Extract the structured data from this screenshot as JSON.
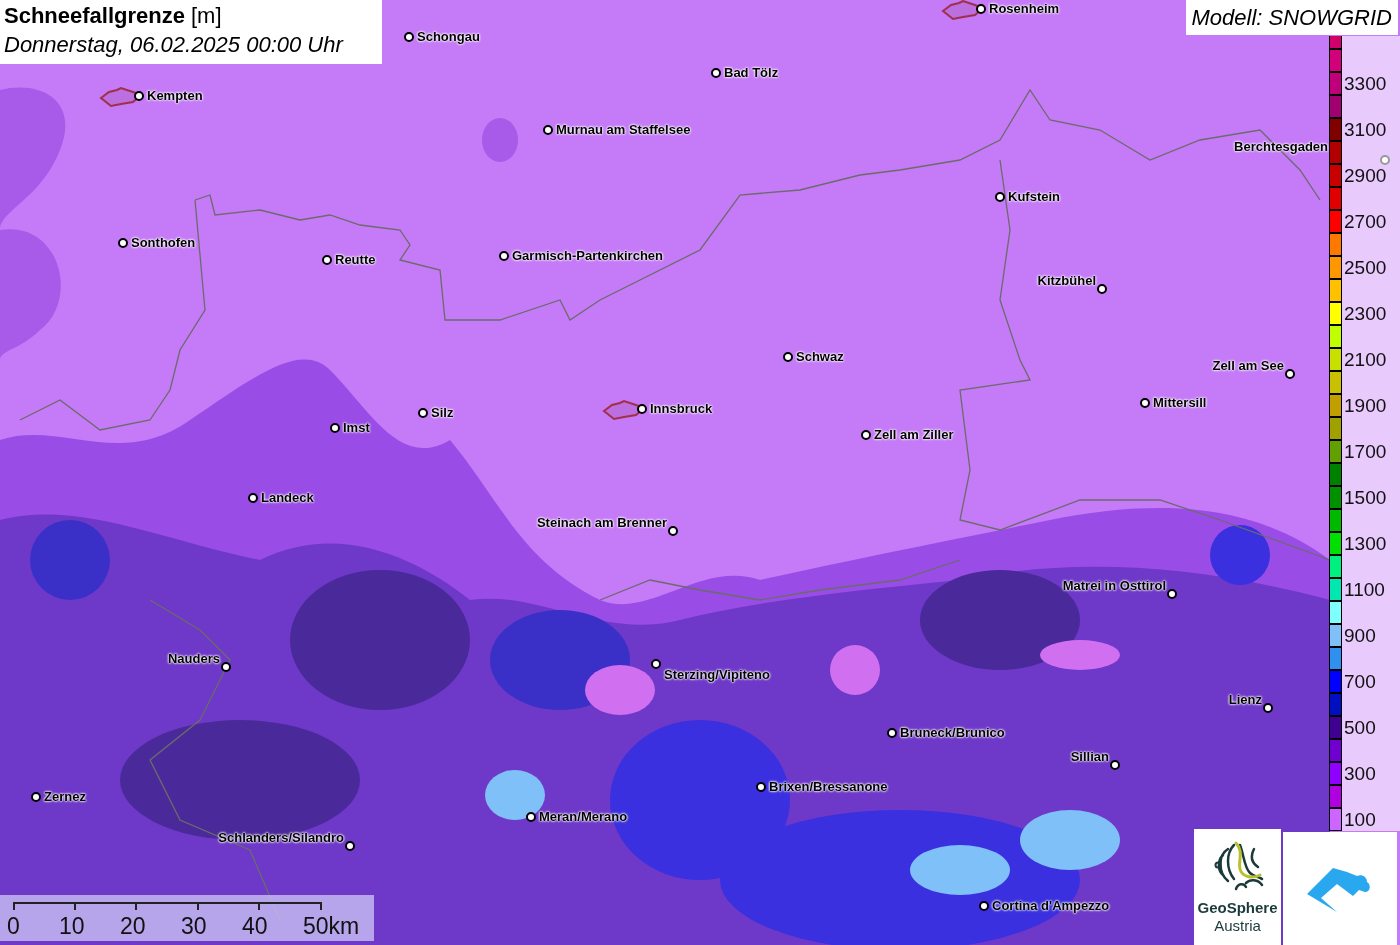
{
  "title": {
    "name": "Schneefallgrenze",
    "unit": "[m]",
    "date": "Donnerstag, 06.02.2025 00:00 Uhr"
  },
  "model": "Modell: SNOWGRID",
  "legend": [
    {
      "color": "#d0006a"
    },
    {
      "color": "#d2007a"
    },
    {
      "color": "#c0007a",
      "label": "3300"
    },
    {
      "color": "#a00070"
    },
    {
      "color": "#800000",
      "label": "3100"
    },
    {
      "color": "#b00000"
    },
    {
      "color": "#c80000",
      "label": "2900"
    },
    {
      "color": "#e00000"
    },
    {
      "color": "#ff0000",
      "label": "2700"
    },
    {
      "color": "#ff7800"
    },
    {
      "color": "#ff9800",
      "label": "2500"
    },
    {
      "color": "#ffc000"
    },
    {
      "color": "#ffff00",
      "label": "2300"
    },
    {
      "color": "#c0ff00"
    },
    {
      "color": "#c8e000",
      "label": "2100"
    },
    {
      "color": "#c8c000"
    },
    {
      "color": "#c0a000",
      "label": "1900"
    },
    {
      "color": "#a0a000"
    },
    {
      "color": "#60a000",
      "label": "1700"
    },
    {
      "color": "#008000"
    },
    {
      "color": "#009000",
      "label": "1500"
    },
    {
      "color": "#00b800"
    },
    {
      "color": "#00e000",
      "label": "1300"
    },
    {
      "color": "#00f080"
    },
    {
      "color": "#00e8b0",
      "label": "1100"
    },
    {
      "color": "#80ffff"
    },
    {
      "color": "#80c0f8",
      "label": "900"
    },
    {
      "color": "#3090f0"
    },
    {
      "color": "#0000ff",
      "label": "700"
    },
    {
      "color": "#0010c0"
    },
    {
      "color": "#400090",
      "label": "500"
    },
    {
      "color": "#7000d0"
    },
    {
      "color": "#9000ff",
      "label": "300"
    },
    {
      "color": "#b000e0"
    },
    {
      "color": "#cc66ff",
      "label": "100"
    }
  ],
  "cities": [
    {
      "name": "Rosenheim",
      "outlined": true
    },
    {
      "name": "Schongau",
      "outlined": false
    },
    {
      "name": "Bad Tölz",
      "outlined": false
    },
    {
      "name": "Kempten",
      "outlined": true
    },
    {
      "name": "Murnau am Staffelsee",
      "outlined": false
    },
    {
      "name": "Berchtesgaden",
      "outlined": false
    },
    {
      "name": "Kufstein",
      "outlined": false
    },
    {
      "name": "Sonthofen",
      "outlined": false
    },
    {
      "name": "Reutte",
      "outlined": false
    },
    {
      "name": "Garmisch-Partenkirchen",
      "outlined": false
    },
    {
      "name": "Kitzbühel",
      "outlined": false
    },
    {
      "name": "Schwaz",
      "outlined": false
    },
    {
      "name": "Zell am See",
      "outlined": false
    },
    {
      "name": "Mittersill",
      "outlined": false
    },
    {
      "name": "Silz",
      "outlined": false
    },
    {
      "name": "Innsbruck",
      "outlined": true
    },
    {
      "name": "Imst",
      "outlined": false
    },
    {
      "name": "Zell am Ziller",
      "outlined": false
    },
    {
      "name": "Landeck",
      "outlined": false
    },
    {
      "name": "Steinach am Brenner",
      "outlined": false
    },
    {
      "name": "Matrei in Osttirol",
      "outlined": false
    },
    {
      "name": "Nauders",
      "outlined": false
    },
    {
      "name": "Sterzing/Vipiteno",
      "outlined": false
    },
    {
      "name": "Lienz",
      "outlined": false
    },
    {
      "name": "Bruneck/Brunico",
      "outlined": false
    },
    {
      "name": "Brixen/Bressanone",
      "outlined": false
    },
    {
      "name": "Sillian",
      "outlined": false
    },
    {
      "name": "Zernez",
      "outlined": false
    },
    {
      "name": "Meran/Merano",
      "outlined": false
    },
    {
      "name": "Schlanders/Silandro",
      "outlined": false
    },
    {
      "name": "Cortina d'Ampezzo",
      "outlined": false
    }
  ],
  "scale_bar": {
    "ticks": [
      "0",
      "10",
      "20",
      "30",
      "40",
      "50km"
    ]
  },
  "logo": {
    "name": "GeoSphere",
    "subtitle": "Austria"
  }
}
